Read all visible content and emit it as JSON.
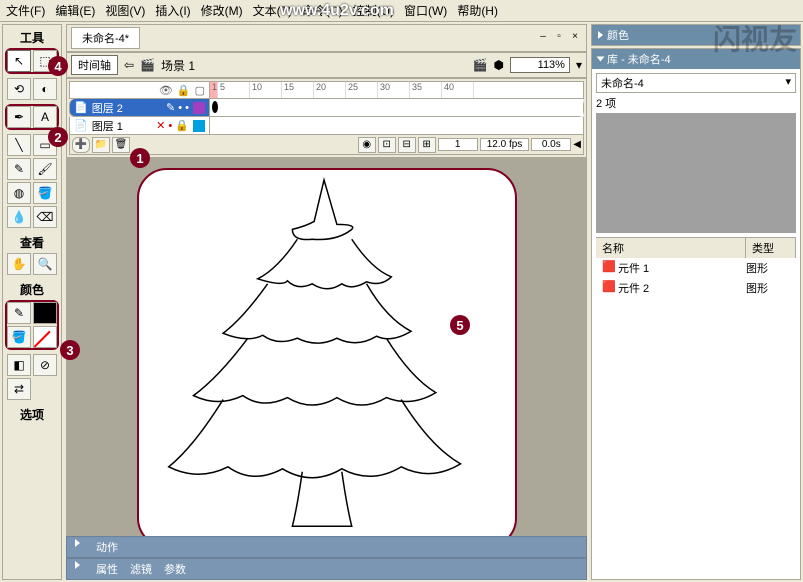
{
  "watermark": "www.4u2v.com",
  "logo": "闪视友",
  "menu": [
    "文件(F)",
    "编辑(E)",
    "视图(V)",
    "插入(I)",
    "修改(M)",
    "文本(T)",
    "命令(C)",
    "控制(O)",
    "窗口(W)",
    "帮助(H)"
  ],
  "doc": {
    "tab": "未命名-4*"
  },
  "tools": {
    "hdr": "工具",
    "view_hdr": "查看",
    "color_hdr": "颜色",
    "opts_hdr": "选项"
  },
  "timeline": {
    "btn": "时间轴",
    "scene": "场景 1",
    "zoom": "113%",
    "ticks": [
      "1",
      "5",
      "10",
      "15",
      "20",
      "25",
      "30",
      "35",
      "40"
    ],
    "layers": [
      {
        "name": "图层 2",
        "sw": "#a040c0",
        "sel": true
      },
      {
        "name": "图层 1",
        "sw": "#00a0e0",
        "sel": false
      }
    ],
    "status": {
      "frame": "1",
      "fps": "12.0 fps",
      "time": "0.0s"
    }
  },
  "panels": {
    "actions": "动作",
    "tabs": [
      "属性",
      "滤镜",
      "参数"
    ]
  },
  "right": {
    "color_hdr": "颜色",
    "lib_hdr": "库 - 未命名-4",
    "lib_combo": "未命名-4",
    "count": "2 项",
    "cols": {
      "name": "名称",
      "type": "类型"
    },
    "items": [
      {
        "name": "元件 1",
        "type": "图形"
      },
      {
        "name": "元件 2",
        "type": "图形"
      }
    ]
  },
  "anno": [
    "1",
    "2",
    "3",
    "4",
    "5"
  ]
}
